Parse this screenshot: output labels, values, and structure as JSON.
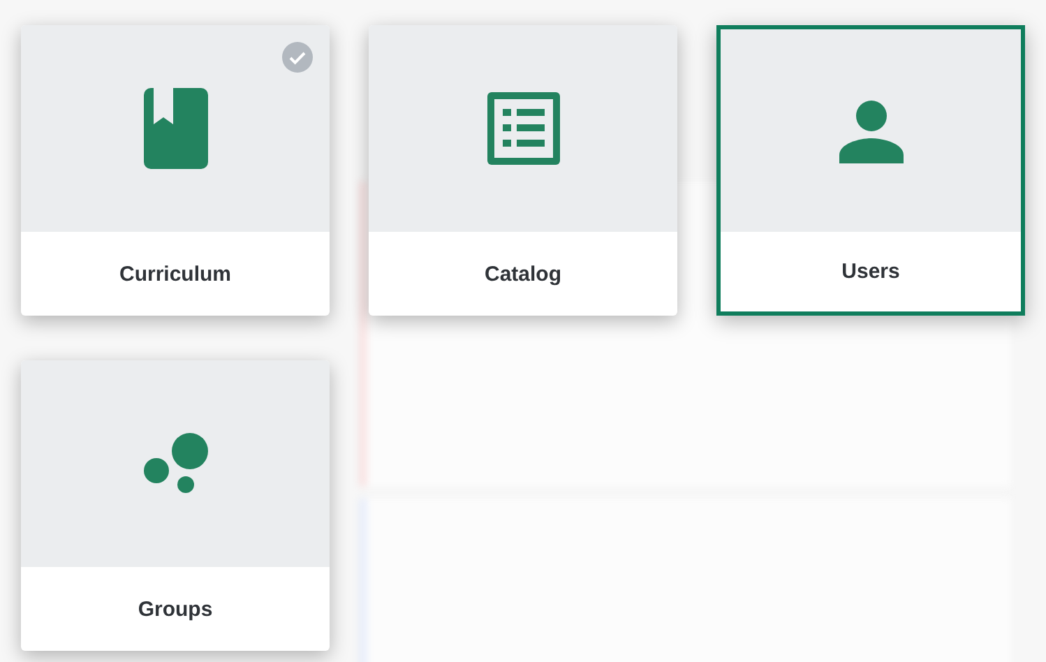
{
  "tiles": [
    {
      "label": "Curriculum",
      "kind": "book",
      "selected": false,
      "checked": true
    },
    {
      "label": "Catalog",
      "kind": "list",
      "selected": false,
      "checked": false
    },
    {
      "label": "Users",
      "kind": "person",
      "selected": true,
      "checked": false
    },
    {
      "label": "Groups",
      "kind": "bubbles",
      "selected": false,
      "checked": false
    }
  ]
}
